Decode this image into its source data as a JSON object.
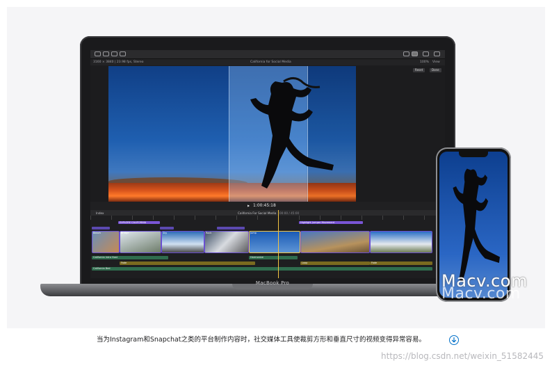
{
  "app": {
    "info_left": "3160 × 3840 | 23.98 fps, Stereo",
    "project_title": "California for Social Media",
    "zoom": "100%",
    "view_label": "View",
    "reset_label": "Reset",
    "done_label": "Done",
    "timecode": "1:00:45:18",
    "timeline_index_label": "Index",
    "timeline_project": "California For Social Media",
    "timeline_duration": "00:00 / 45:00"
  },
  "timeline": {
    "connected_titles": [
      "EXPLORE CALIFORNIA",
      "Highlight Jumper Movement"
    ],
    "clip_labels": [
      "Beach",
      "Bridge",
      "Sky",
      "Rock",
      "Jump"
    ],
    "audio_labels": [
      "California Intro Host",
      "Fade",
      "Harmonize",
      "Loop",
      "Fade",
      "California Bed"
    ]
  },
  "device": {
    "brand": "MacBook Pro"
  },
  "caption": {
    "text": "当为Instagram和Snapchat之类的平台制作内容时，社交媒体工具使裁剪方形和垂直尺寸的视频变得异常容易。"
  },
  "watermark": {
    "primary": "Macv.com",
    "secondary": "Macv.com",
    "csdn": "https://blog.csdn.net/weixin_51582445"
  },
  "colors": {
    "accent_blue": "#0070c9",
    "crop_highlight": "#96c8ff",
    "title_purple": "#6a4fd0"
  },
  "icons": [
    "download-icon",
    "undo-icon",
    "share-icon",
    "key-icon"
  ]
}
